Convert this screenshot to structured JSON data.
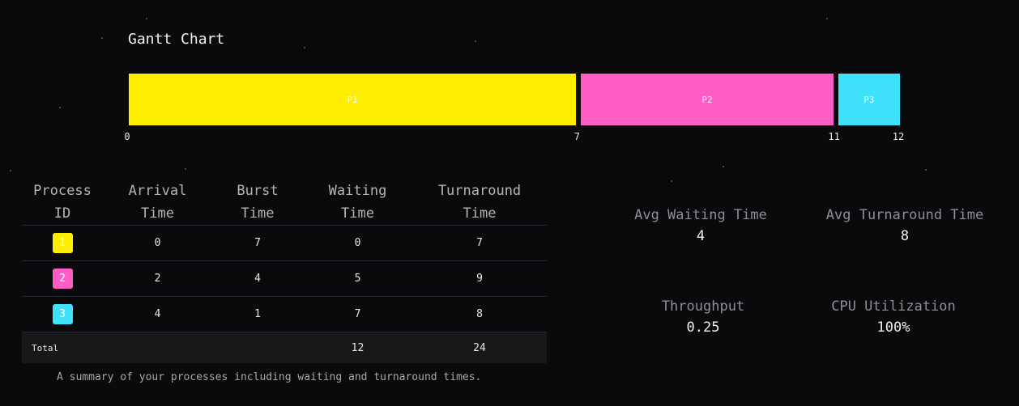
{
  "gantt": {
    "title": "Gantt Chart",
    "segments": [
      {
        "label": "P1",
        "start": 0,
        "end": 7,
        "color": "#ffee00"
      },
      {
        "label": "P2",
        "start": 7,
        "end": 11,
        "color": "#ff5cc4"
      },
      {
        "label": "P3",
        "start": 11,
        "end": 12,
        "color": "#3ee2fb"
      }
    ],
    "ticks": [
      "0",
      "7",
      "11",
      "12"
    ]
  },
  "table": {
    "headers": [
      [
        "Process",
        "ID"
      ],
      [
        "Arrival",
        "Time"
      ],
      [
        "Burst",
        "Time"
      ],
      [
        "Waiting",
        "Time"
      ],
      [
        "Turnaround",
        "Time"
      ]
    ],
    "rows": [
      {
        "id": "1",
        "color": "#ffee00",
        "arrival": "0",
        "burst": "7",
        "waiting": "0",
        "turnaround": "7"
      },
      {
        "id": "2",
        "color": "#ff5cc4",
        "arrival": "2",
        "burst": "4",
        "waiting": "5",
        "turnaround": "9"
      },
      {
        "id": "3",
        "color": "#3ee2fb",
        "arrival": "4",
        "burst": "1",
        "waiting": "7",
        "turnaround": "8"
      }
    ],
    "total": {
      "label": "Total",
      "waiting": "12",
      "turnaround": "24"
    },
    "caption": "A summary of your processes including waiting and turnaround times."
  },
  "stats": {
    "avg_waiting_label": "Avg Waiting Time",
    "avg_waiting_value": "4",
    "avg_turnaround_label": "Avg Turnaround Time",
    "avg_turnaround_value": "8",
    "throughput_label": "Throughput",
    "throughput_value": "0.25",
    "cpu_util_label": "CPU Utilization",
    "cpu_util_value": "100%"
  }
}
